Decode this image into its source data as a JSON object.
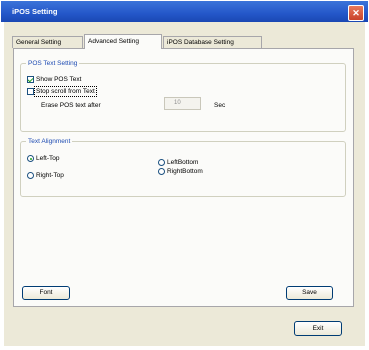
{
  "window": {
    "title": "iPOS Setting"
  },
  "tabs": [
    {
      "label": "General Setting"
    },
    {
      "label": "Advanced Setting"
    },
    {
      "label": "iPOS Database Setting"
    }
  ],
  "pos_text_group": {
    "title": "POS Text Setting",
    "show_pos_text": {
      "label": "Show POS Text",
      "checked": true
    },
    "stop_scroll": {
      "label": "Stop scroll from Text",
      "checked": false
    },
    "erase_label": "Erase POS text after",
    "erase_value": "10",
    "erase_unit": "Sec"
  },
  "alignment_group": {
    "title": "Text Alignment",
    "options": [
      {
        "label": "Left-Top",
        "checked": true
      },
      {
        "label": "Right-Top",
        "checked": false
      },
      {
        "label": "LeftBottom",
        "checked": false
      },
      {
        "label": "RightBottom",
        "checked": false
      }
    ]
  },
  "buttons": {
    "font": "Font",
    "save": "Save",
    "exit": "Exit"
  },
  "colors": {
    "titlebar": "#2457c9",
    "dialog_bg": "#ece9d8",
    "group_title": "#1f4cb3"
  }
}
